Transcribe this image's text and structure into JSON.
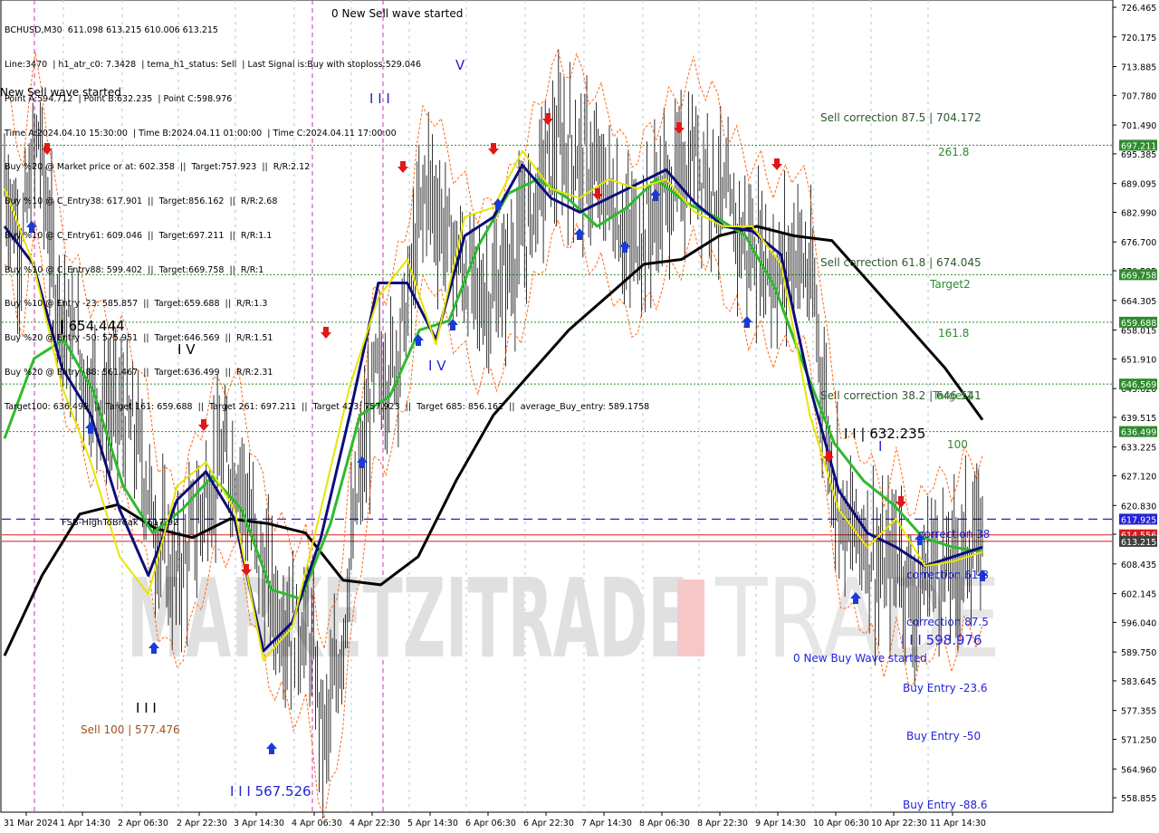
{
  "header": {
    "lines": [
      "BCHUSD,M30  611.098 613.215 610.006 613.215",
      "Line:3470  | h1_atr_c0: 7.3428  | tema_h1_status: Sell  | Last Signal is:Buy with stoploss:529.046",
      "Point A:594.712  | Point B:632.235  | Point C:598.976",
      "Time A:2024.04.10 15:30:00  | Time B:2024.04.11 01:00:00  | Time C:2024.04.11 17:00:00",
      "Buy %20 @ Market price or at: 602.358  ||  Target:757.923  ||  R/R:2.12",
      "Buy %10 @ C_Entry38: 617.901  ||  Target:856.162  ||  R/R:2.68",
      "Buy %10 @ C_Entry61: 609.046  ||  Target:697.211  ||  R/R:1.1",
      "Buy %10 @ C_Entry88: 599.402  ||  Target:669.758  ||  R/R:1",
      "Buy %10 @ Entry -23: 585.857  ||  Target:659.688  ||  R/R:1.3",
      "Buy %20 @ Entry -50: 575.951  ||  Target:646.569  ||  R/R:1.51",
      "Buy %20 @ Entry -88: 561.467  ||  Target:636.499  ||  R/R:2.31",
      "Target100: 636.499  ||  Target 161: 659.688  ||  Target 261: 697.211  ||  Target 423: 757.923  ||  Target 685: 856.162  ||  average_Buy_entry: 589.1758"
    ]
  },
  "watermark": "MARKETZITRADE",
  "axis": {
    "y_ticks": [
      "726.465",
      "720.175",
      "713.885",
      "707.780",
      "701.490",
      "695.385",
      "689.095",
      "682.990",
      "676.700",
      "670.595",
      "664.305",
      "658.015",
      "651.910",
      "645.620",
      "639.515",
      "633.225",
      "627.120",
      "620.830",
      "614.725",
      "608.435",
      "602.145",
      "596.040",
      "589.750",
      "583.645",
      "577.355",
      "571.250",
      "564.960",
      "558.855"
    ],
    "x_ticks": [
      "31 Mar 2024",
      "1 Apr 14:30",
      "2 Apr 06:30",
      "2 Apr 22:30",
      "3 Apr 14:30",
      "4 Apr 06:30",
      "4 Apr 22:30",
      "5 Apr 14:30",
      "6 Apr 06:30",
      "6 Apr 22:30",
      "7 Apr 14:30",
      "8 Apr 06:30",
      "8 Apr 22:30",
      "9 Apr 14:30",
      "10 Apr 06:30",
      "10 Apr 22:30",
      "11 Apr 14:30"
    ]
  },
  "price_tags": [
    {
      "value": 697.211,
      "label": "697.211",
      "color": "#2e8b2e"
    },
    {
      "value": 669.758,
      "label": "669.758",
      "color": "#2e8b2e"
    },
    {
      "value": 659.688,
      "label": "659.688",
      "color": "#2e8b2e"
    },
    {
      "value": 646.569,
      "label": "646.569",
      "color": "#2e8b2e"
    },
    {
      "value": 636.499,
      "label": "636.499",
      "color": "#2e8b2e"
    },
    {
      "value": 617.925,
      "label": "617.925",
      "color": "#2323d6"
    },
    {
      "value": 614.6,
      "label": "614.556",
      "color": "#e01818"
    },
    {
      "value": 613.215,
      "label": "613.215",
      "color": "#404040"
    }
  ],
  "annotations": {
    "new_sell": "0 New Sell wave started",
    "new_sell_left": "New Sell wave started",
    "new_buy": "0 New Buy Wave started",
    "sell_87": "Sell correction 87.5 | 704.172",
    "sell_61": "Sell correction 61.8 | 674.045",
    "sell_38": "Sell correction 38.2 | 646.541",
    "lvl_261": "261.8",
    "lvl_target2": "Target2",
    "lvl_161": "161.8",
    "lvl_target1": "Target1",
    "lvl_100": "100",
    "wave_654": "| | 654.444",
    "wave_iv": "I V",
    "wave_iv2": "I V",
    "wave_iii": "I I I",
    "wave_v": "V",
    "wave_v2": "I V",
    "wave_i": "I",
    "wave_632": "I I | 632.235",
    "wave_598": "I I I 598.976",
    "wave_567": "I I I 567.526",
    "sell100": "Sell 100 | 577.476",
    "fsb": "FSB-HighToBreak | 617.92",
    "corr38": "correction 38",
    "corr618": "correction 61.8",
    "corr875": "correction 87.5",
    "buy23": "Buy Entry -23.6",
    "buy50": "Buy Entry -50",
    "buy88": "Buy Entry -88.6"
  },
  "chart_data": {
    "type": "line",
    "symbol": "BCHUSD",
    "timeframe": "M30",
    "ylim": [
      555.8,
      728.0
    ],
    "x_range": [
      "31 Mar 2024",
      "11 Apr 2024"
    ],
    "horizontal_levels": [
      {
        "name": "261.8",
        "value": 697.211
      },
      {
        "name": "Target2",
        "value": 669.758
      },
      {
        "name": "161.8",
        "value": 659.688
      },
      {
        "name": "Target1",
        "value": 646.569
      },
      {
        "name": "100",
        "value": 636.499
      },
      {
        "name": "FSB-HighToBreak",
        "value": 617.925
      },
      {
        "name": "Last",
        "value": 613.215
      }
    ],
    "series": [
      {
        "name": "price_close",
        "color": "#000000",
        "values": [
          690,
          676,
          700,
          668,
          655,
          647,
          642,
          640,
          633,
          615,
          605,
          612,
          624,
          630,
          628,
          610,
          600,
          595,
          595,
          570,
          592,
          624,
          648,
          650,
          665,
          690,
          680,
          672,
          666,
          665,
          672,
          680,
          692,
          697,
          695,
          690,
          686,
          676,
          680,
          686,
          690,
          695,
          690,
          682,
          676,
          674,
          670,
          676,
          665,
          630,
          615,
          615,
          605,
          612,
          600,
          610,
          606,
          612,
          613
        ]
      },
      {
        "name": "sma_black",
        "color": "#000000",
        "values": [
          589,
          606,
          619,
          621,
          616,
          614,
          618,
          617,
          615,
          605,
          604,
          610,
          626,
          640,
          649,
          658,
          665,
          672,
          673,
          678,
          680,
          678,
          677,
          668,
          659,
          650,
          639
        ]
      },
      {
        "name": "ma_green",
        "color": "#2dbb2d",
        "values": [
          635,
          652,
          656,
          645,
          625,
          615,
          620,
          627,
          620,
          603,
          601,
          617,
          640,
          644,
          658,
          660,
          676,
          687,
          690,
          686,
          680,
          684,
          690,
          685,
          682,
          678,
          667,
          650,
          634,
          626,
          621,
          614,
          612,
          611
        ]
      },
      {
        "name": "ma_navy",
        "color": "#0d0d7a",
        "values": [
          680,
          672,
          650,
          640,
          620,
          606,
          622,
          628,
          618,
          590,
          596,
          614,
          640,
          668,
          668,
          656,
          678,
          682,
          693,
          686,
          683,
          686,
          689,
          692,
          685,
          680,
          679,
          674,
          646,
          624,
          615,
          612,
          608,
          610,
          612
        ]
      },
      {
        "name": "ma_yellow",
        "color": "#e6e600",
        "values": [
          688,
          672,
          646,
          630,
          610,
          602,
          625,
          630,
          620,
          588,
          595,
          620,
          646,
          665,
          673,
          655,
          682,
          684,
          696,
          688,
          686,
          690,
          688,
          690,
          683,
          680,
          680,
          672,
          640,
          620,
          612,
          618,
          608,
          609,
          611
        ]
      }
    ]
  }
}
